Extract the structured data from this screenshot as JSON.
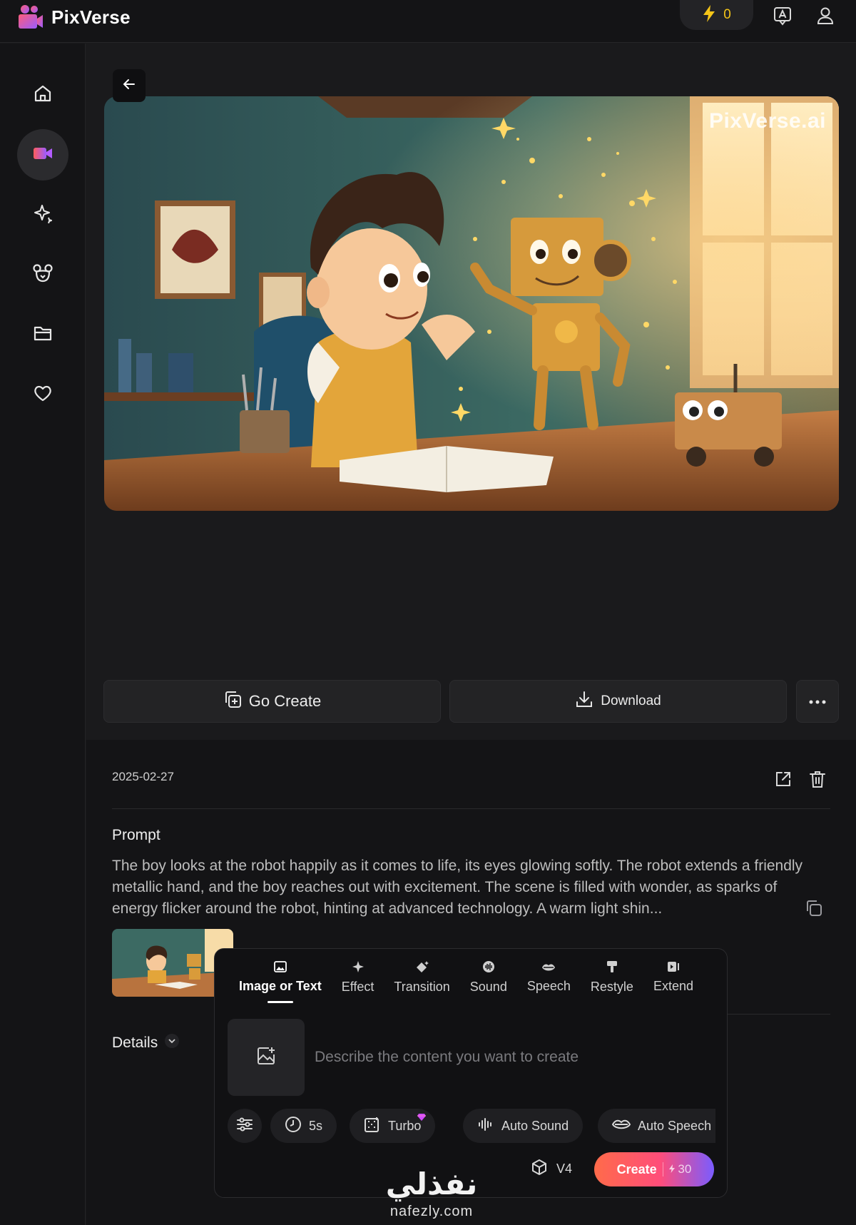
{
  "app": {
    "name": "PixVerse"
  },
  "header": {
    "credits": "0"
  },
  "media": {
    "watermark": "PixVerse.ai"
  },
  "actions": {
    "go_create": "Go Create",
    "download": "Download"
  },
  "details_panel": {
    "date": "2025-02-27",
    "prompt_label": "Prompt",
    "prompt_text": "The boy looks at the robot happily as it comes to life, its eyes glowing softly. The robot extends a friendly metallic hand, and the boy reaches out with excitement. The scene is filled with wonder, as sparks of energy flicker around the robot, hinting at advanced technology. A warm light shin...",
    "details_label": "Details"
  },
  "create_popup": {
    "tabs": [
      {
        "label": "Image or Text",
        "icon": "image-icon"
      },
      {
        "label": "Effect",
        "icon": "sparkle-icon"
      },
      {
        "label": "Transition",
        "icon": "diamond-sparkle-icon"
      },
      {
        "label": "Sound",
        "icon": "sound-icon"
      },
      {
        "label": "Speech",
        "icon": "lips-icon"
      },
      {
        "label": "Restyle",
        "icon": "brush-icon"
      },
      {
        "label": "Extend",
        "icon": "extend-icon"
      }
    ],
    "placeholder": "Describe the content you want to create",
    "chips": {
      "duration": "5s",
      "turbo": "Turbo",
      "auto_sound": "Auto Sound",
      "auto_speech": "Auto Speech"
    },
    "version": "V4",
    "create_label": "Create",
    "create_cost": "30"
  },
  "overlay": {
    "brand_ar": "نفذلي",
    "brand_latin": "nafezly.com"
  },
  "colors": {
    "accent_yellow": "#f5c518",
    "create_gradient_start": "#ff6b4a",
    "create_gradient_end": "#7a5cff",
    "active_video_icon": "#ff4d6d"
  }
}
